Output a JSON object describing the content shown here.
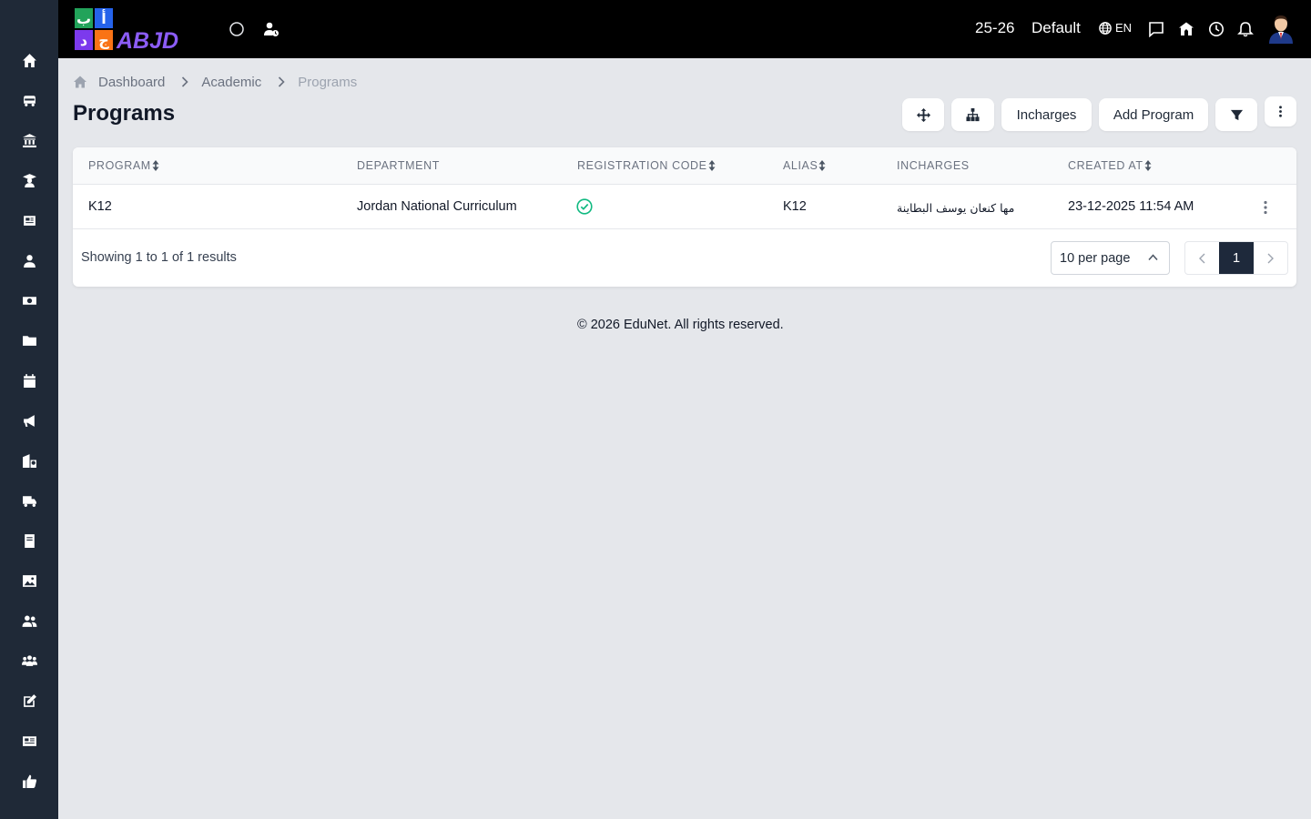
{
  "app": {
    "logo_text": "ABJD",
    "logo_letters": [
      "ب",
      "أ",
      "د",
      "ج"
    ]
  },
  "topbar": {
    "session": "25-26",
    "profile": "Default",
    "language": "EN",
    "icons": [
      "circle-icon",
      "user-clock-icon",
      "globe-icon",
      "chat-icon",
      "school-icon",
      "clock-icon",
      "bell-icon",
      "avatar"
    ]
  },
  "sidebar": {
    "items": [
      {
        "icon": "home-icon"
      },
      {
        "icon": "bus-icon"
      },
      {
        "icon": "institution-icon"
      },
      {
        "icon": "graduate-icon"
      },
      {
        "icon": "news-icon"
      },
      {
        "icon": "teacher-icon"
      },
      {
        "icon": "money-icon"
      },
      {
        "icon": "folder-icon"
      },
      {
        "icon": "calendar-icon"
      },
      {
        "icon": "megaphone-icon"
      },
      {
        "icon": "hostel-icon"
      },
      {
        "icon": "truck-icon"
      },
      {
        "icon": "book-icon"
      },
      {
        "icon": "image-icon"
      },
      {
        "icon": "users-icon"
      },
      {
        "icon": "group-icon"
      },
      {
        "icon": "edit-icon"
      },
      {
        "icon": "newspaper-icon"
      },
      {
        "icon": "thumbs-up-icon"
      }
    ]
  },
  "breadcrumb": {
    "items": [
      "Dashboard",
      "Academic",
      "Programs"
    ]
  },
  "page": {
    "title": "Programs"
  },
  "actions": {
    "incharges": "Incharges",
    "add_program": "Add Program"
  },
  "table": {
    "columns": [
      "Program",
      "Department",
      "Registration code",
      "Alias",
      "Incharges",
      "Created at"
    ],
    "rows": [
      {
        "program": "K12",
        "department": "Jordan National Curriculum",
        "registration_code": "check",
        "alias": "K12",
        "incharges": "مها كنعان يوسف البطاينة",
        "created_at": "23-12-2025 11:54 AM"
      }
    ]
  },
  "pagination": {
    "showing": "Showing 1 to 1 of 1 results",
    "per_page": "10 per page",
    "current_page": "1"
  },
  "footer": {
    "text": "© 2026 EduNet. All rights reserved."
  },
  "colors": {
    "sidebar": "#1f2937",
    "topbar": "#000000",
    "background": "#e5e7eb",
    "success": "#10b981",
    "active_page": "#1e293b"
  }
}
